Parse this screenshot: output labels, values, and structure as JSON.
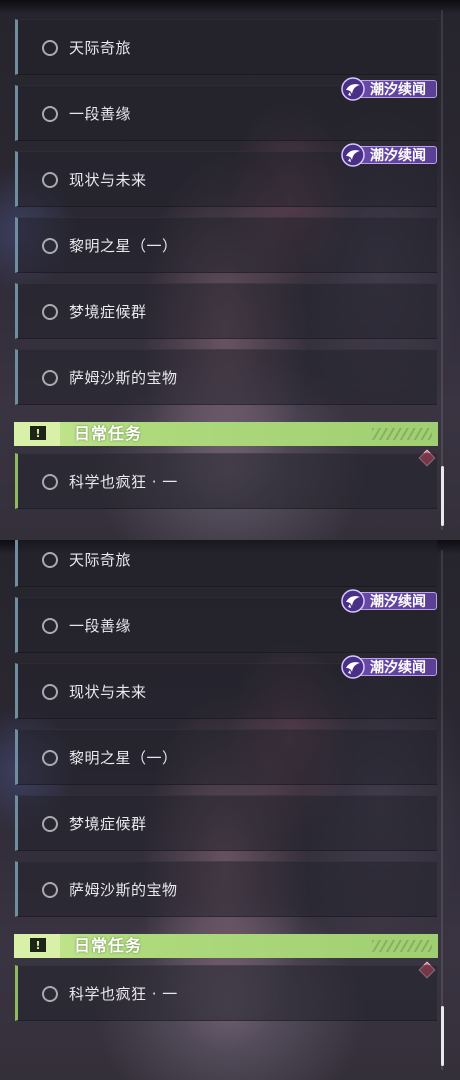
{
  "quests": [
    {
      "label": "天际奇旅"
    },
    {
      "label": "一段善缘"
    },
    {
      "label": "现状与未来"
    },
    {
      "label": "黎明之星（一）"
    },
    {
      "label": "梦境症候群"
    },
    {
      "label": "萨姆沙斯的宝物"
    }
  ],
  "tag_label": "潮汐续闻",
  "daily": {
    "title": "日常任务",
    "warn_symbol": "!",
    "quest": {
      "label": "科学也疯狂 · 一"
    }
  },
  "icons": {
    "quest_status": "circle-outline-icon",
    "tag_emblem": "tide-emblem-icon",
    "daily_header": "exclamation-box-icon",
    "new_marker": "red-diamond-icon"
  },
  "colors": {
    "quest_accent": "#6f8ea0",
    "daily_accent": "#8dbb62",
    "header_green": "#aeda7c",
    "tag_purple": "#6a4ba8",
    "new_marker": "#e0506a"
  }
}
